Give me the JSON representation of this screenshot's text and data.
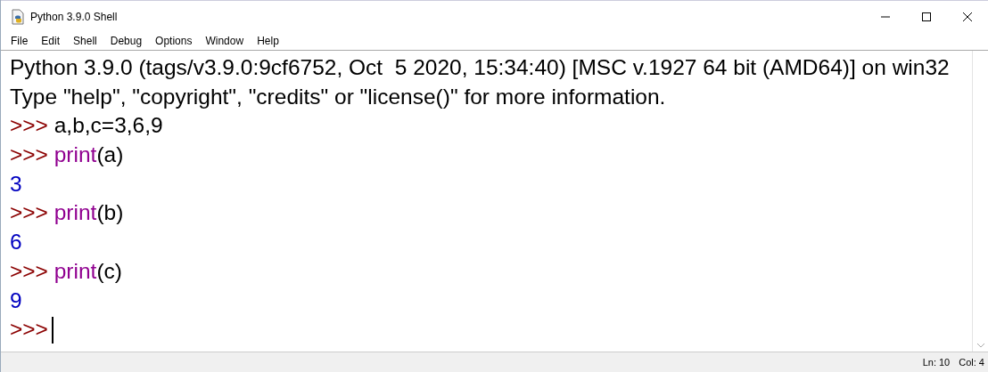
{
  "window": {
    "title": "Python 3.9.0 Shell"
  },
  "menu": [
    "File",
    "Edit",
    "Shell",
    "Debug",
    "Options",
    "Window",
    "Help"
  ],
  "lines": [
    [
      {
        "kind": "plain",
        "text": "Python 3.9.0 (tags/v3.9.0:9cf6752, Oct  5 2020, 15:34:40) [MSC v.1927 64 bit (AMD64)] on win32"
      }
    ],
    [
      {
        "kind": "plain",
        "text": "Type \"help\", \"copyright\", \"credits\" or \"license()\" for more information."
      }
    ],
    [
      {
        "kind": "prompt",
        "text": ">>> "
      },
      {
        "kind": "code",
        "text": "a,b,c=3,6,9"
      }
    ],
    [
      {
        "kind": "prompt",
        "text": ">>> "
      },
      {
        "kind": "builtin",
        "text": "print"
      },
      {
        "kind": "code",
        "text": "(a)"
      }
    ],
    [
      {
        "kind": "output",
        "text": "3"
      }
    ],
    [
      {
        "kind": "prompt",
        "text": ">>> "
      },
      {
        "kind": "builtin",
        "text": "print"
      },
      {
        "kind": "code",
        "text": "(b)"
      }
    ],
    [
      {
        "kind": "output",
        "text": "6"
      }
    ],
    [
      {
        "kind": "prompt",
        "text": ">>> "
      },
      {
        "kind": "builtin",
        "text": "print"
      },
      {
        "kind": "code",
        "text": "(c)"
      }
    ],
    [
      {
        "kind": "output",
        "text": "9"
      }
    ],
    [
      {
        "kind": "prompt",
        "text": ">>>"
      }
    ]
  ],
  "status_bar": {
    "line": "Ln: 10",
    "col": "Col: 4"
  }
}
